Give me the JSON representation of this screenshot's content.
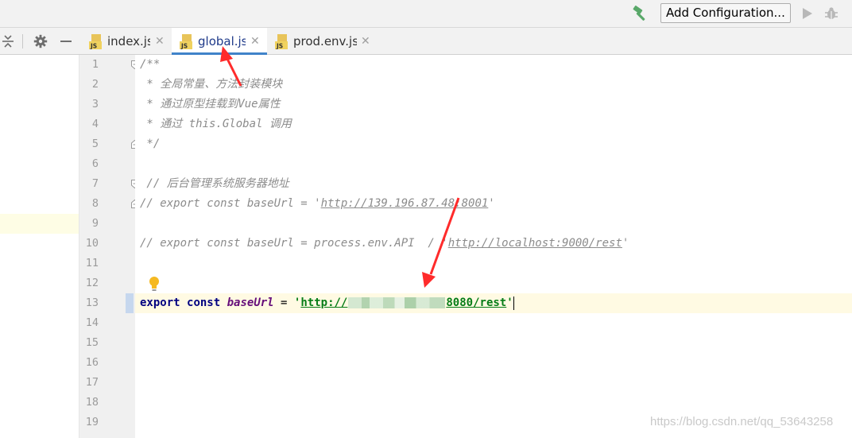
{
  "toolbar": {
    "build_icon": "hammer-icon",
    "add_configuration_label": "Add Configuration...",
    "run_icon": "play-icon",
    "debug_icon": "bug-icon"
  },
  "tabs": [
    {
      "label": "index.js",
      "icon": "js-file-icon",
      "active": false
    },
    {
      "label": "global.js",
      "icon": "js-file-icon",
      "active": true
    },
    {
      "label": "prod.env.js",
      "icon": "js-file-icon",
      "active": false
    }
  ],
  "tab_close_glyph": "✕",
  "line_numbers": [
    "1",
    "2",
    "3",
    "4",
    "5",
    "6",
    "7",
    "8",
    "9",
    "10",
    "11",
    "12",
    "13",
    "14",
    "15",
    "16",
    "17",
    "18",
    "19"
  ],
  "code": {
    "l1": "/**",
    "l2": " * 全局常量、方法封装模块",
    "l3": " * 通过原型挂载到Vue属性",
    "l4": " * 通过 this.Global 调用",
    "l5": " */",
    "l7": " // 后台管理系统服务器地址",
    "l8_prefix": "// export const baseUrl = '",
    "l8_url": "http://139.196.87.48:8001",
    "l8_suffix": "'",
    "l10_prefix": "// export const baseUrl = process.env.API  / '",
    "l10_url": "http://localhost:9000/rest",
    "l10_suffix": "'",
    "l13_kw1": "export",
    "l13_kw2": "const",
    "l13_var": "baseUrl",
    "l13_eq": " = ",
    "l13_quote": "'",
    "l13_url_start": "http://",
    "l13_url_end": "8080/rest",
    "l13_quote_end": "'"
  },
  "colors": {
    "accent_tab_underline": "#4083c9",
    "annotation_arrow": "#ff2b2b",
    "keyword": "#000080",
    "string": "#067d17",
    "comment": "#8c8c8c"
  },
  "watermark": "https://blog.csdn.net/qq_53643258"
}
